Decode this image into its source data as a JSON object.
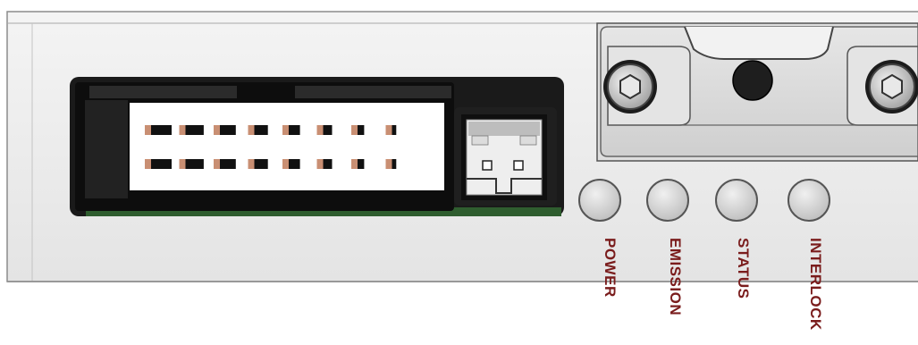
{
  "colors": {
    "panel": "#ececec",
    "panel_edge": "#9a9a9a",
    "label": "#7a1c1c",
    "connector_body": "#111111",
    "pin": "#c98f73",
    "pcb": "#2f5d2f",
    "led": "#d6d6d6"
  },
  "indicators": [
    {
      "label": "POWER",
      "icon": "led-indicator"
    },
    {
      "label": "EMISSION",
      "icon": "led-indicator"
    },
    {
      "label": "STATUS",
      "icon": "led-indicator"
    },
    {
      "label": "INTERLOCK",
      "icon": "led-indicator"
    }
  ],
  "connector": {
    "pin_rows": 2,
    "pins_per_row": 8
  }
}
